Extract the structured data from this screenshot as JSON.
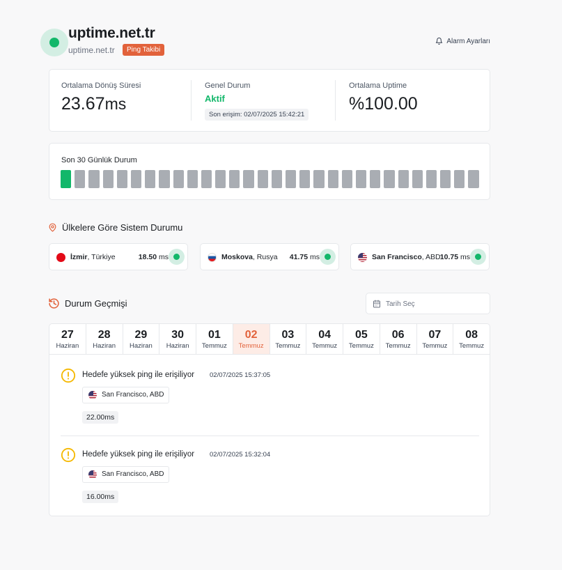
{
  "header": {
    "title": "uptime.net.tr",
    "subtitle": "uptime.net.tr",
    "badge": "Ping Takibi",
    "alarm_label": "Alarm Ayarları"
  },
  "stats": {
    "avg_rtt_label": "Ortalama Dönüş Süresi",
    "avg_rtt_value": "23.67",
    "avg_rtt_unit": "ms",
    "status_label": "Genel Durum",
    "status_value": "Aktif",
    "last_access": "Son erişim: 02/07/2025 15:42:21",
    "uptime_label": "Ortalama Uptime",
    "uptime_value": "%100.00"
  },
  "last30": {
    "label": "Son 30 Günlük Durum",
    "days": [
      "up",
      "nodata",
      "nodata",
      "nodata",
      "nodata",
      "nodata",
      "nodata",
      "nodata",
      "nodata",
      "nodata",
      "nodata",
      "nodata",
      "nodata",
      "nodata",
      "nodata",
      "nodata",
      "nodata",
      "nodata",
      "nodata",
      "nodata",
      "nodata",
      "nodata",
      "nodata",
      "nodata",
      "nodata",
      "nodata",
      "nodata",
      "nodata",
      "nodata",
      "nodata"
    ]
  },
  "countries": {
    "title": "Ülkelere Göre Sistem Durumu",
    "items": [
      {
        "city": "İzmir",
        "country": ", Türkiye",
        "ms": "18.50",
        "unit": " ms"
      },
      {
        "city": "Moskova",
        "country": ", Rusya",
        "ms": "41.75",
        "unit": " ms"
      },
      {
        "city": "San Francisco",
        "country": ", ABD",
        "ms": "10.75",
        "unit": " ms"
      }
    ]
  },
  "history": {
    "title": "Durum Geçmişi",
    "date_placeholder": "Tarih Seç",
    "days": [
      {
        "num": "27",
        "month": "Haziran"
      },
      {
        "num": "28",
        "month": "Haziran"
      },
      {
        "num": "29",
        "month": "Haziran"
      },
      {
        "num": "30",
        "month": "Haziran"
      },
      {
        "num": "01",
        "month": "Temmuz"
      },
      {
        "num": "02",
        "month": "Temmuz"
      },
      {
        "num": "03",
        "month": "Temmuz"
      },
      {
        "num": "04",
        "month": "Temmuz"
      },
      {
        "num": "05",
        "month": "Temmuz"
      },
      {
        "num": "06",
        "month": "Temmuz"
      },
      {
        "num": "07",
        "month": "Temmuz"
      },
      {
        "num": "08",
        "month": "Temmuz"
      }
    ],
    "active_day": "02",
    "events": [
      {
        "title": "Hedefe yüksek ping ile erişiliyor",
        "time": "02/07/2025 15:37:05",
        "location": "San Francisco, ABD",
        "ms": "22.00ms"
      },
      {
        "title": "Hedefe yüksek ping ile erişiliyor",
        "time": "02/07/2025 15:32:04",
        "location": "San Francisco, ABD",
        "ms": "16.00ms"
      }
    ]
  },
  "colors": {
    "accent": "#e2623b",
    "success": "#12b76a",
    "warning": "#f5b800",
    "bar_nodata": "#a9adb3"
  }
}
